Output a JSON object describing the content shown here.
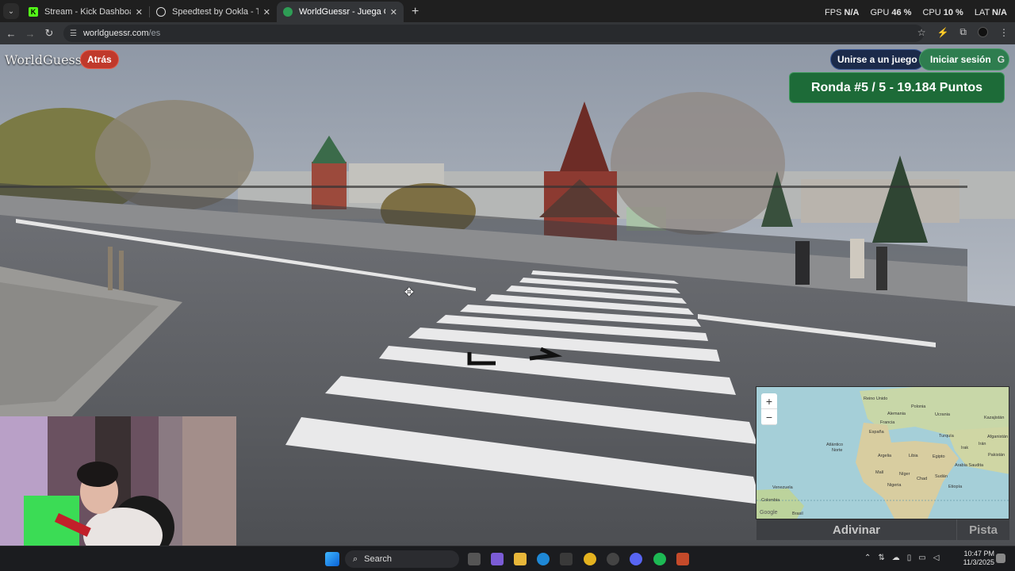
{
  "browser": {
    "tabs": [
      {
        "title": "Stream - Kick Dashboard",
        "icon": "kick-icon",
        "active": false
      },
      {
        "title": "Speedtest by Ookla - The Global",
        "icon": "speedtest-icon",
        "active": false
      },
      {
        "title": "WorldGuessr - Juega GeoGuessr",
        "icon": "worldguessr-icon",
        "active": true
      }
    ],
    "new_tab_label": "+",
    "url_host": "worldguessr.com",
    "url_path": "/es",
    "perf": {
      "fps_label": "FPS",
      "fps_value": "N/A",
      "gpu_label": "GPU",
      "gpu_value": "46 %",
      "cpu_label": "CPU",
      "cpu_value": "10 %",
      "lat_label": "LAT",
      "lat_value": "N/A"
    }
  },
  "game": {
    "brand": "WorldGuessr",
    "back_button": "Atrás",
    "join_button": "Unirse a un juego",
    "login_button": "Iniciar sesión",
    "login_icon": "google-icon",
    "round_banner": "Ronda #5 / 5 - 19.184 Puntos",
    "guess_button": "Adivinar",
    "hint_button": "Pista",
    "zoom_in": "+",
    "zoom_out": "−",
    "map_labels": {
      "ocean": "Atlántico",
      "ocean2": "Norte",
      "uk": "Reino Unido",
      "poland": "Polonia",
      "germany": "Alemania",
      "ukraine": "Ucrania",
      "kazakhstan": "Kazajistán",
      "france": "Francia",
      "spain": "España",
      "turkey": "Turquía",
      "iraq": "Irak",
      "iran": "Irán",
      "afghanistan": "Afganistán",
      "pakistan": "Pakistán",
      "algeria": "Argelia",
      "libya": "Libia",
      "egypt": "Egipto",
      "saudi": "Arabia Saudita",
      "mali": "Malí",
      "niger": "Níger",
      "chad": "Chad",
      "sudan": "Sudán",
      "nigeria": "Nigeria",
      "ethiopia": "Etiopía",
      "venezuela": "Venezuela",
      "colombia": "Colombia",
      "brazil": "Brasil",
      "google": "Google"
    }
  },
  "taskbar": {
    "search_placeholder": "Search",
    "time": "10:47 PM",
    "date": "11/3/2025"
  },
  "colors": {
    "round_bg": "#1d6b38",
    "back_bg": "#c0392b",
    "join_bg": "#1b2a4a",
    "login_bg": "#2e7d4f",
    "ocean": "#a5cfd8",
    "land": "#c8d7a8"
  }
}
